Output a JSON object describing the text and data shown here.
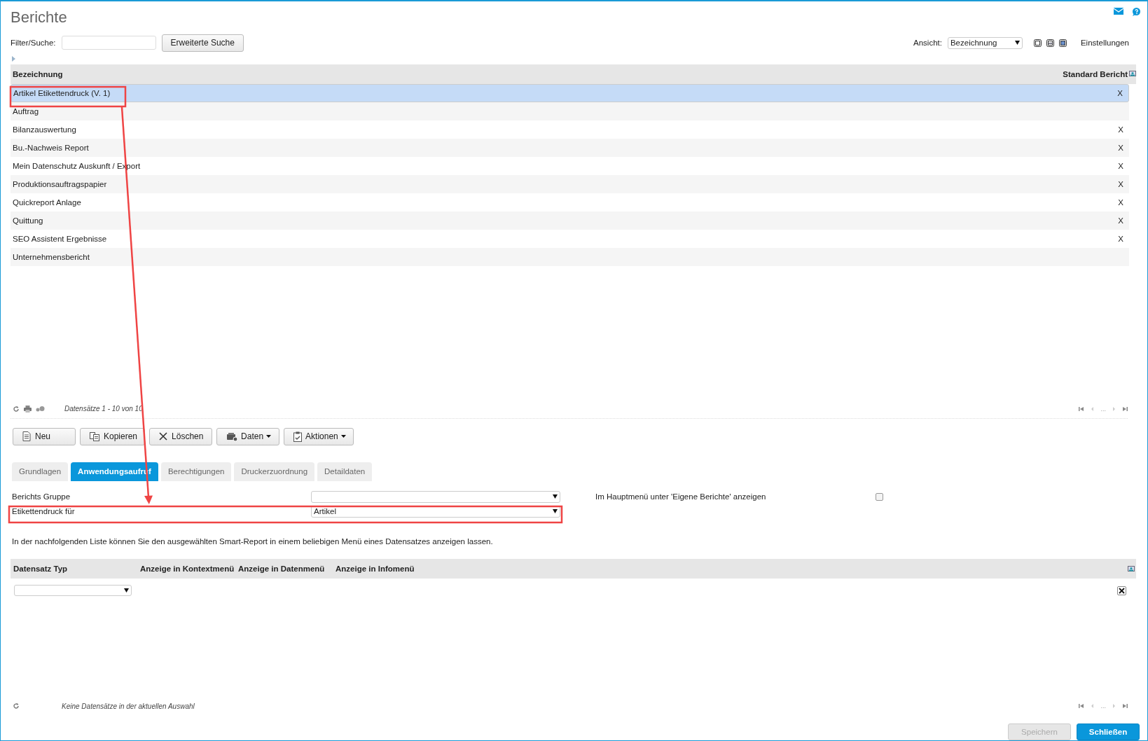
{
  "title": "Berichte",
  "filter": {
    "label": "Filter/Suche:",
    "button": "Erweiterte Suche"
  },
  "view": {
    "label": "Ansicht:",
    "value": "Bezeichnung",
    "settings": "Einstellungen"
  },
  "reports_table": {
    "columns": [
      "Bezeichnung",
      "Standard Bericht"
    ],
    "rows": [
      {
        "name": "Artikel Etikettendruck (V. 1)",
        "standard": "X",
        "selected": true
      },
      {
        "name": "Auftrag",
        "selected": false
      },
      {
        "name": "Bilanzauswertung",
        "standard": "X",
        "selected": false
      },
      {
        "name": "Bu.-Nachweis Report",
        "standard": "X",
        "selected": false
      },
      {
        "name": "Mein Datenschutz Auskunft / Export",
        "standard": "X",
        "selected": false
      },
      {
        "name": "Produktionsauftragspapier",
        "standard": "X",
        "selected": false
      },
      {
        "name": "Quickreport Anlage",
        "standard": "X",
        "selected": false
      },
      {
        "name": "Quittung",
        "standard": "X",
        "selected": false
      },
      {
        "name": "SEO Assistent Ergebnisse",
        "standard": "X",
        "selected": false
      },
      {
        "name": "Unternehmensbericht",
        "selected": false
      }
    ]
  },
  "reports_footer": {
    "status": "Datensätze 1 - 10 von 10",
    "pager_gap": "..."
  },
  "toolbar": [
    {
      "label": "Neu",
      "kind": "new",
      "dropdown": false
    },
    {
      "label": "Kopieren",
      "kind": "copy",
      "dropdown": false
    },
    {
      "label": "Löschen",
      "kind": "delete",
      "dropdown": false
    },
    {
      "label": "Daten",
      "kind": "data",
      "dropdown": true
    },
    {
      "label": "Aktionen",
      "kind": "actions",
      "dropdown": true
    }
  ],
  "tabs": [
    {
      "label": "Grundlagen",
      "selected": false
    },
    {
      "label": "Anwendungsaufruf",
      "selected": true
    },
    {
      "label": "Berechtigungen",
      "selected": false
    },
    {
      "label": "Druckerzuordnung",
      "selected": false
    },
    {
      "label": "Detaildaten",
      "selected": false
    }
  ],
  "form": {
    "fields": [
      {
        "label": "Berichts Gruppe"
      },
      {
        "label": "Etikettendruck für",
        "value": "Artikel"
      }
    ],
    "menu_checkbox": {
      "label": "Im Hauptmenü unter 'Eigene Berichte' anzeigen",
      "checked": false
    }
  },
  "info_text": "In der nachfolgenden Liste können Sie den ausgewählten Smart-Report in einem beliebigen Menü eines Datensatzes anzeigen lassen.",
  "menu_table": {
    "columns": [
      "Datensatz Typ",
      "Anzeige in Kontextmenü",
      "Anzeige in Datenmenü",
      "Anzeige in Infomenü"
    ]
  },
  "menu_footer": {
    "status": "Keine Datensätze in der aktuellen Auswahl",
    "pager_gap": "..."
  },
  "actions": [
    {
      "label": "Speichern",
      "disabled": true
    },
    {
      "label": "Schließen",
      "disabled": false
    }
  ]
}
